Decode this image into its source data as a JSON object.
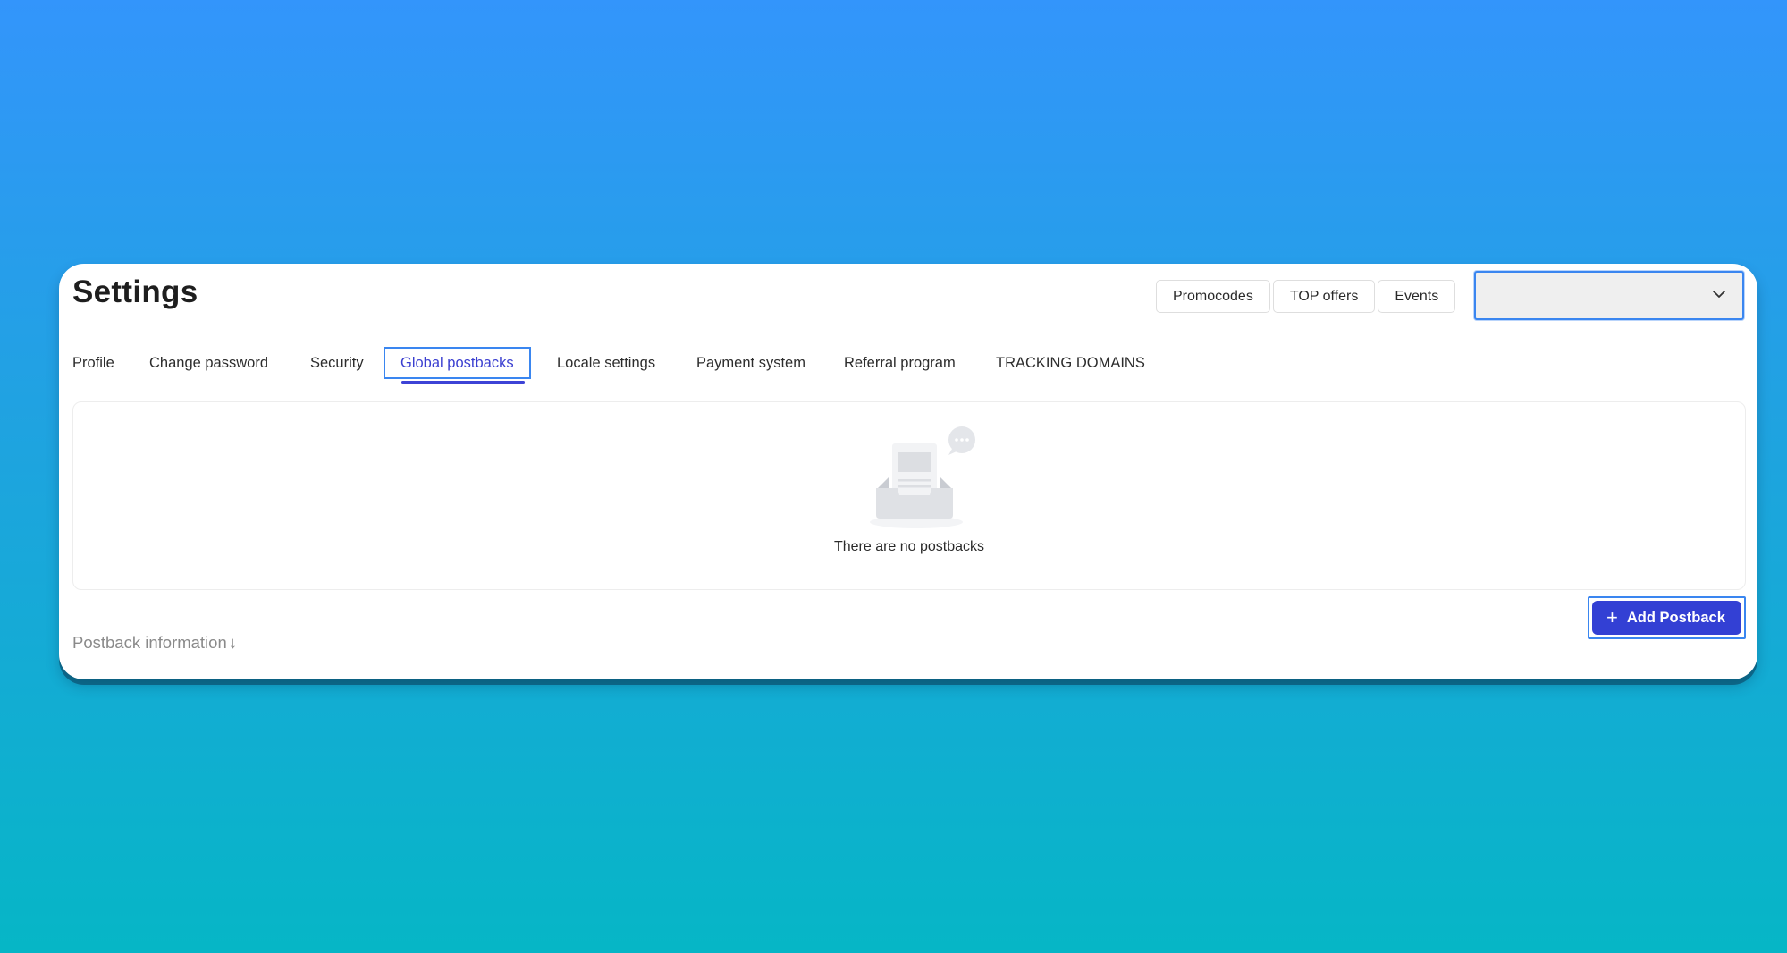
{
  "page": {
    "title": "Settings"
  },
  "header": {
    "buttons": [
      {
        "label": "Promocodes"
      },
      {
        "label": "TOP offers"
      },
      {
        "label": "Events"
      }
    ],
    "select": {
      "value": "",
      "icon": "chevron-down-icon"
    }
  },
  "tabs": [
    {
      "label": "Profile",
      "active": false
    },
    {
      "label": "Change password",
      "active": false
    },
    {
      "label": "Security",
      "active": false
    },
    {
      "label": "Global postbacks",
      "active": true
    },
    {
      "label": "Locale settings",
      "active": false
    },
    {
      "label": "Payment system",
      "active": false
    },
    {
      "label": "Referral program",
      "active": false
    },
    {
      "label": "TRACKING DOMAINS",
      "active": false
    }
  ],
  "empty_state": {
    "icon": "empty-inbox-icon",
    "message": "There are no postbacks"
  },
  "actions": {
    "add_postback_label": "Add Postback",
    "add_postback_icon": "+"
  },
  "footer": {
    "info_link_label": "Postback information",
    "info_link_icon": "↓"
  },
  "colors": {
    "accent": "#3340d4",
    "active_tab_text": "#3b3fd0",
    "focus_outline": "#3a86f0",
    "background_top": "#3395FB",
    "background_bottom": "#06B6C6"
  }
}
